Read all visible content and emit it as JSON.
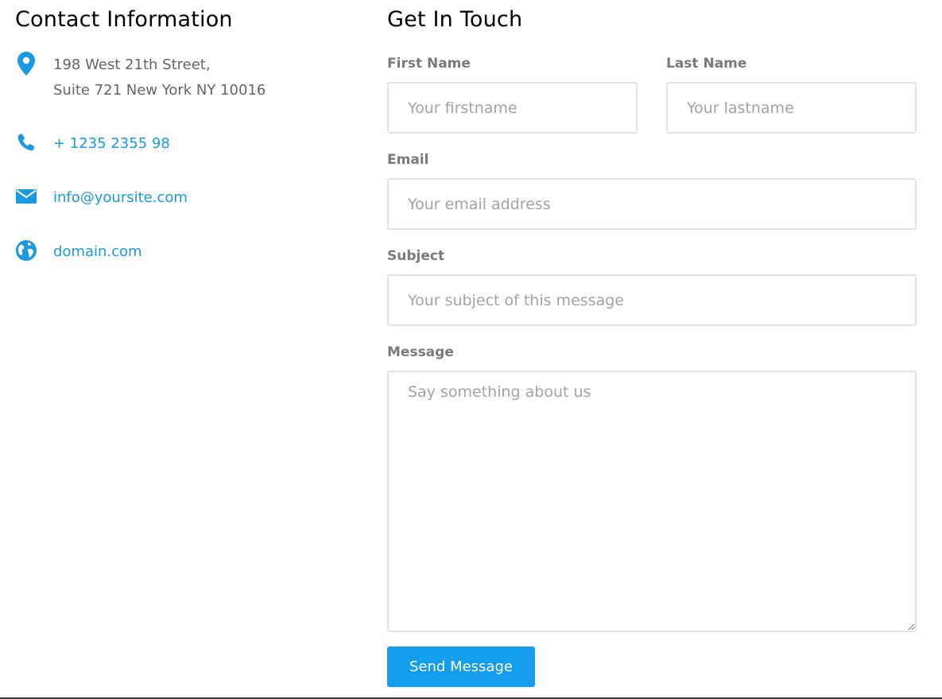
{
  "contact_info": {
    "title": "Contact Information",
    "address_line1": "198 West 21th Street,",
    "address_line2": "Suite 721 New York NY 10016",
    "phone": "+ 1235 2355 98",
    "email": "info@yoursite.com",
    "website": "domain.com",
    "icons": [
      "location-pin-icon",
      "phone-icon",
      "envelope-icon",
      "globe-icon"
    ],
    "accent_color": "#1a9ae0"
  },
  "form": {
    "title": "Get In Touch",
    "first_name": {
      "label": "First Name",
      "placeholder": "Your firstname",
      "value": ""
    },
    "last_name": {
      "label": "Last Name",
      "placeholder": "Your lastname",
      "value": ""
    },
    "email": {
      "label": "Email",
      "placeholder": "Your email address",
      "value": ""
    },
    "subject": {
      "label": "Subject",
      "placeholder": "Your subject of this message",
      "value": ""
    },
    "message": {
      "label": "Message",
      "placeholder": "Say something about us",
      "value": ""
    },
    "submit_label": "Send Message",
    "button_color": "#149ded"
  }
}
